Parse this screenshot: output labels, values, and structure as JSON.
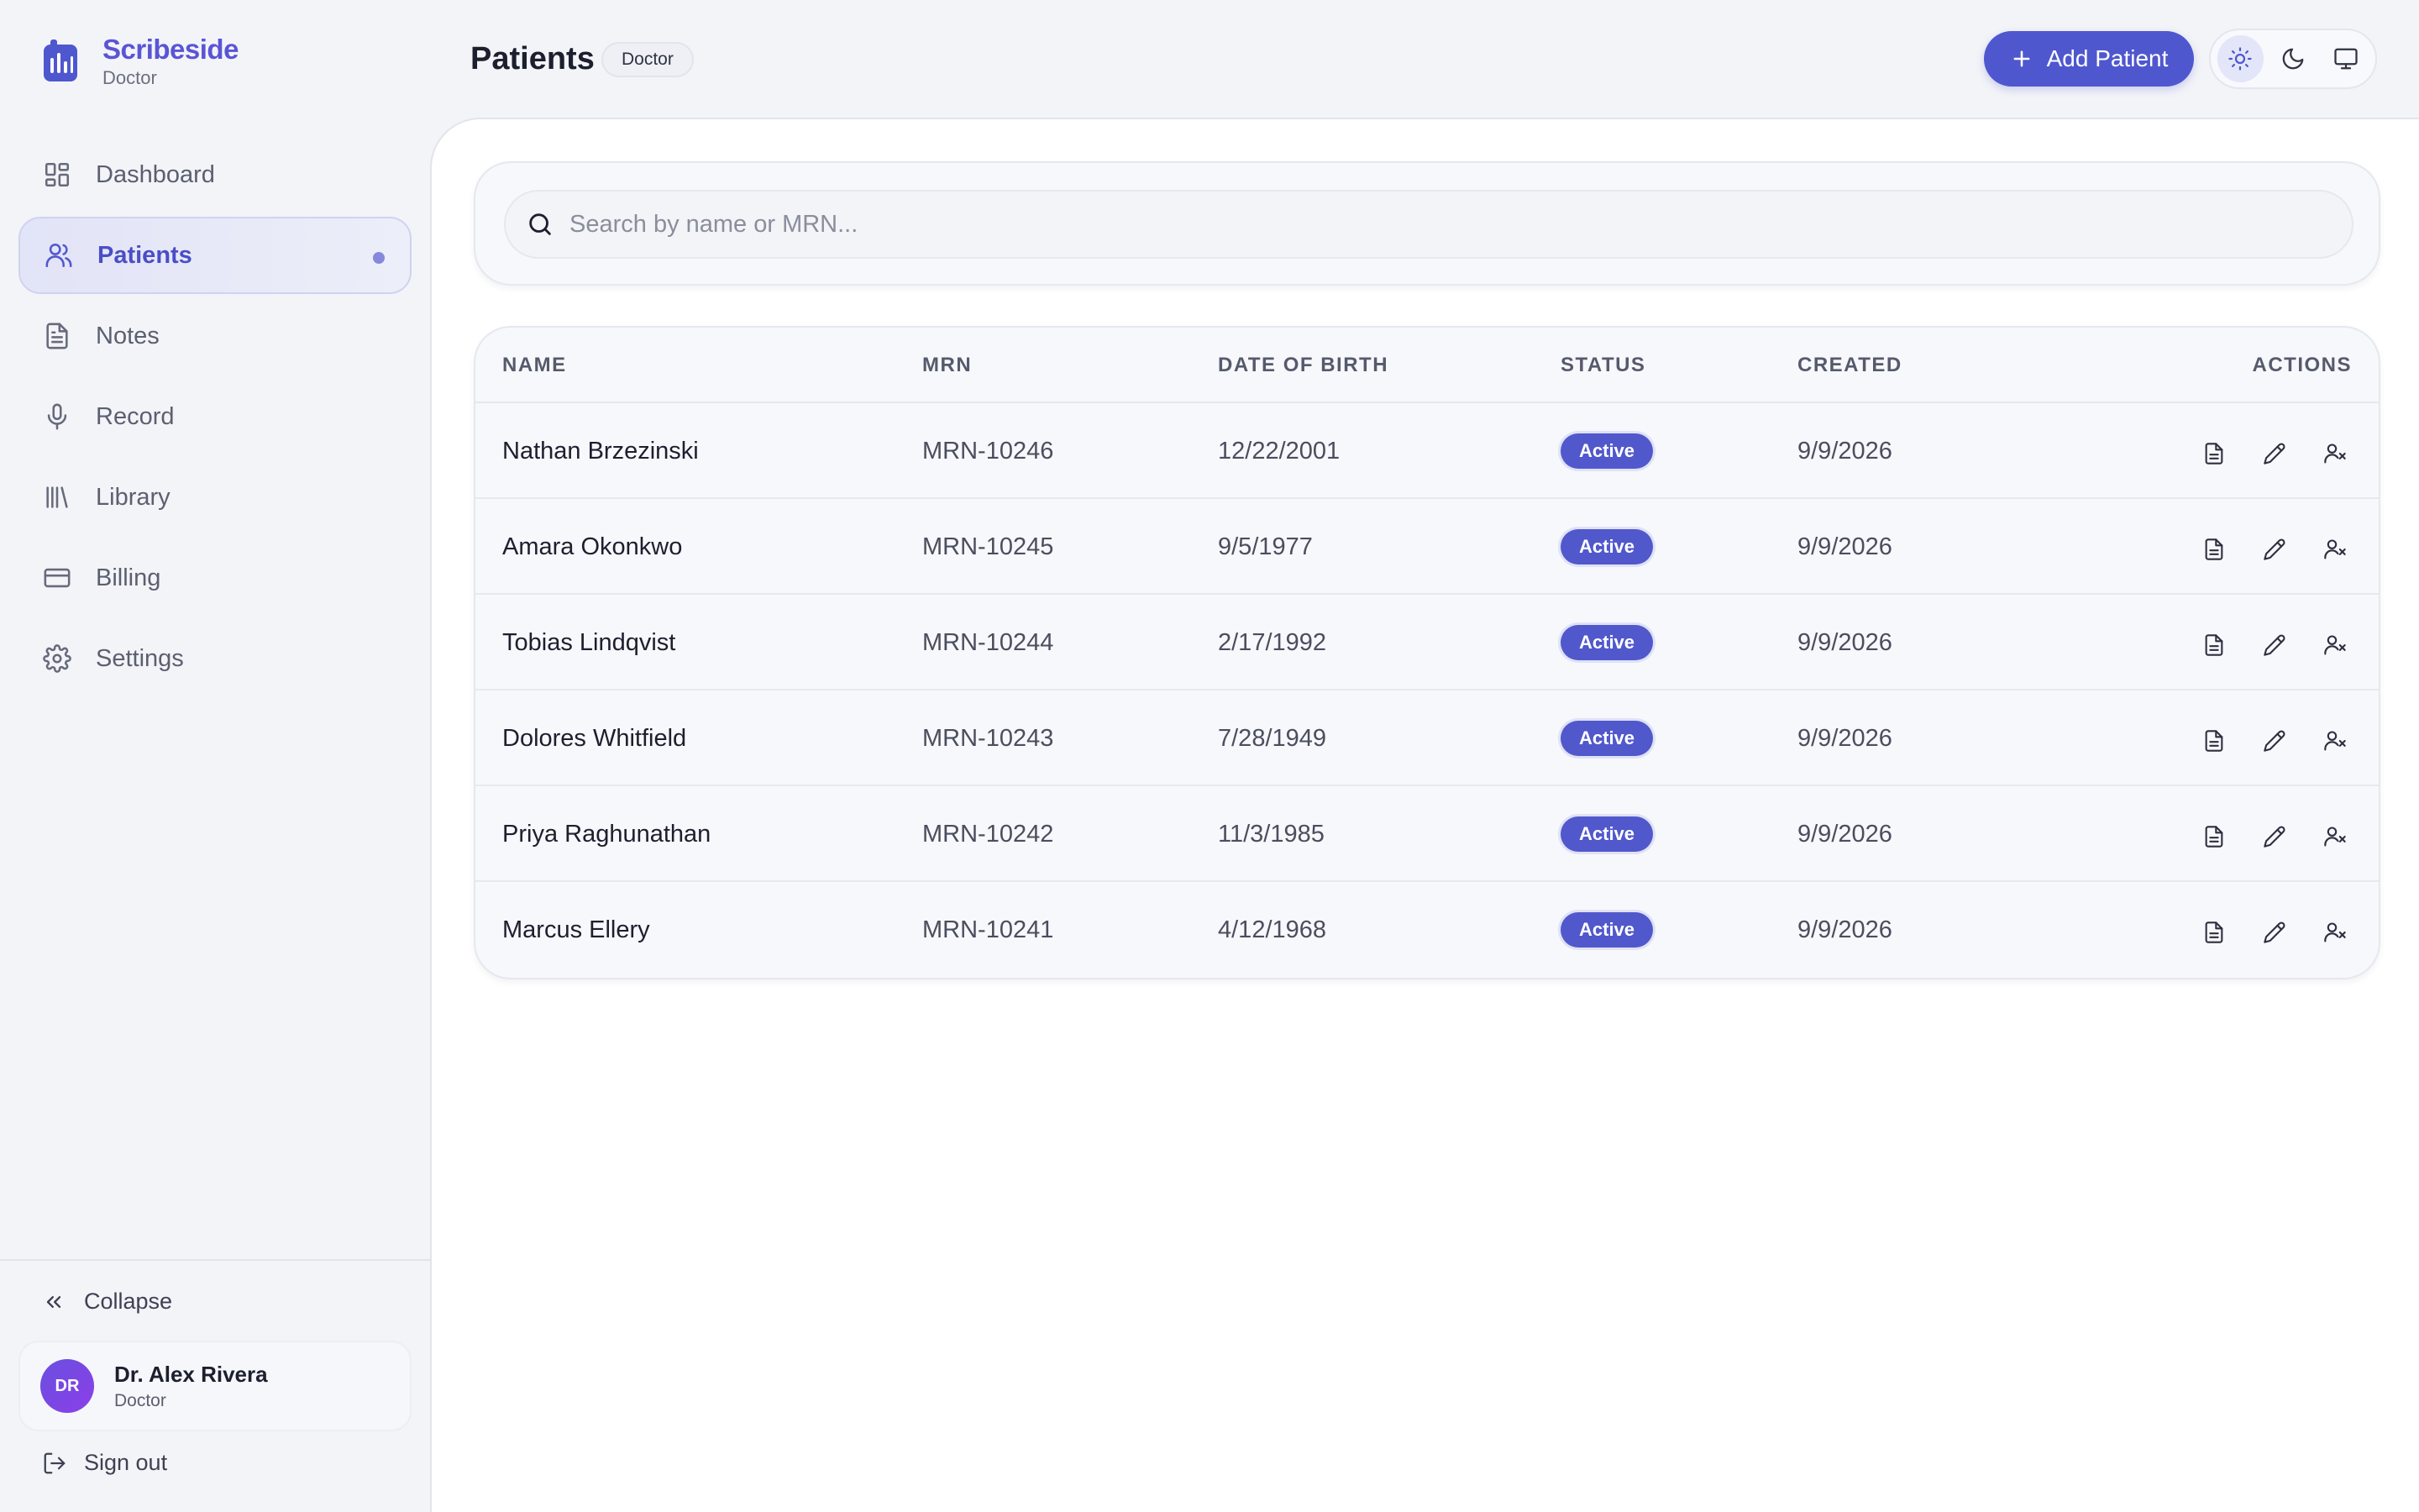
{
  "brand": {
    "name": "Scribeside",
    "subtitle": "Doctor"
  },
  "sidebar": {
    "items": [
      {
        "label": "Dashboard",
        "icon": "dashboard-icon"
      },
      {
        "label": "Patients",
        "icon": "users-icon",
        "active": true
      },
      {
        "label": "Notes",
        "icon": "file-text-icon"
      },
      {
        "label": "Record",
        "icon": "microphone-icon"
      },
      {
        "label": "Library",
        "icon": "library-icon"
      },
      {
        "label": "Billing",
        "icon": "credit-card-icon"
      },
      {
        "label": "Settings",
        "icon": "gear-icon"
      }
    ],
    "collapse_label": "Collapse",
    "user": {
      "initials": "DR",
      "name": "Dr. Alex Rivera",
      "role": "Doctor"
    },
    "signout_label": "Sign out"
  },
  "header": {
    "title": "Patients",
    "role_badge": "Doctor",
    "add_button_label": "Add Patient",
    "theme_options": [
      "light",
      "dark",
      "system"
    ],
    "theme_selected": "light"
  },
  "search": {
    "placeholder": "Search by name or MRN...",
    "value": ""
  },
  "table": {
    "columns": [
      "NAME",
      "MRN",
      "DATE OF BIRTH",
      "STATUS",
      "CREATED",
      "ACTIONS"
    ],
    "rows": [
      {
        "name": "Nathan Brzezinski",
        "mrn": "MRN-10246",
        "dob": "12/22/2001",
        "status": "Active",
        "created": "9/9/2026"
      },
      {
        "name": "Amara Okonkwo",
        "mrn": "MRN-10245",
        "dob": "9/5/1977",
        "status": "Active",
        "created": "9/9/2026"
      },
      {
        "name": "Tobias Lindqvist",
        "mrn": "MRN-10244",
        "dob": "2/17/1992",
        "status": "Active",
        "created": "9/9/2026"
      },
      {
        "name": "Dolores Whitfield",
        "mrn": "MRN-10243",
        "dob": "7/28/1949",
        "status": "Active",
        "created": "9/9/2026"
      },
      {
        "name": "Priya Raghunathan",
        "mrn": "MRN-10242",
        "dob": "11/3/1985",
        "status": "Active",
        "created": "9/9/2026"
      },
      {
        "name": "Marcus Ellery",
        "mrn": "MRN-10241",
        "dob": "4/12/1968",
        "status": "Active",
        "created": "9/9/2026"
      }
    ],
    "row_actions": [
      "notes-icon",
      "edit-icon",
      "deactivate-user-icon"
    ]
  },
  "colors": {
    "accent": "#4f57cf",
    "brand": "#5a55d6",
    "status_active": "#5158cc",
    "background": "#f3f4f8"
  }
}
